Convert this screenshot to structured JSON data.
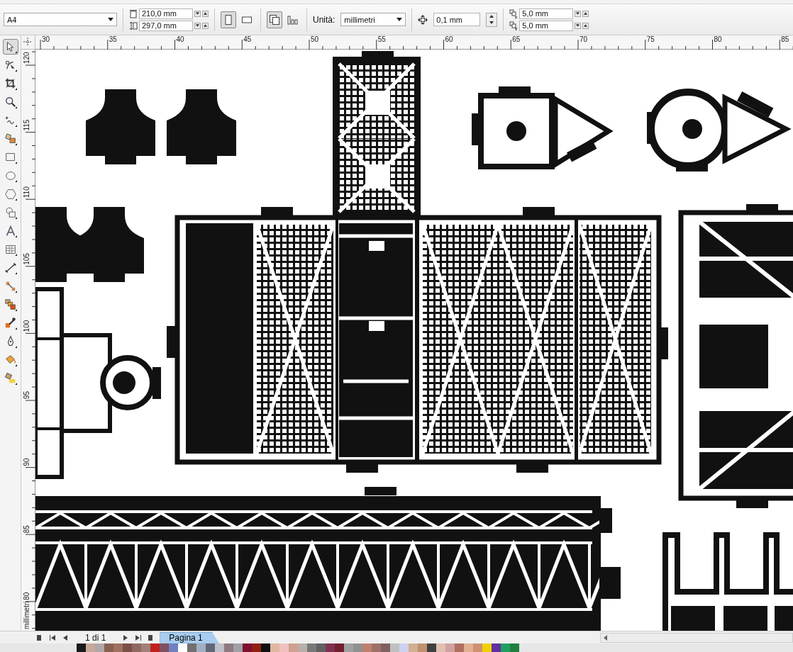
{
  "property_bar": {
    "paper_size": "A4",
    "width": "210,0 mm",
    "height": "297,0 mm",
    "orientations": [
      {
        "kind": "portrait",
        "selected": true
      },
      {
        "kind": "landscape",
        "selected": false
      }
    ],
    "page_modes": [
      {
        "kind": "all_pages",
        "selected": true
      },
      {
        "kind": "current_page",
        "selected": false
      }
    ],
    "units_label": "Unità:",
    "units": "millimetri",
    "nudge": "0,1 mm",
    "duplicate_x": "5,0 mm",
    "duplicate_y": "5,0 mm"
  },
  "toolbox": [
    {
      "kind": "pick",
      "selected": true
    },
    {
      "kind": "shape",
      "selected": false
    },
    {
      "kind": "crop",
      "selected": false
    },
    {
      "kind": "zoom",
      "selected": false
    },
    {
      "kind": "freehand",
      "selected": false
    },
    {
      "kind": "smart_fill",
      "selected": false
    },
    {
      "kind": "rectangle",
      "selected": false
    },
    {
      "kind": "ellipse",
      "selected": false
    },
    {
      "kind": "polygon",
      "selected": false
    },
    {
      "kind": "basic_shapes",
      "selected": false
    },
    {
      "kind": "text",
      "selected": false
    },
    {
      "kind": "table",
      "selected": false
    },
    {
      "kind": "dimension",
      "selected": false
    },
    {
      "kind": "connector",
      "selected": false
    },
    {
      "kind": "blend",
      "selected": false
    },
    {
      "kind": "eyedropper",
      "selected": false
    },
    {
      "kind": "outline",
      "selected": false
    },
    {
      "kind": "fill",
      "selected": false
    },
    {
      "kind": "interactive_fill",
      "selected": false
    }
  ],
  "ruler": {
    "horizontal": [
      "30",
      "35",
      "40",
      "45",
      "50",
      "55",
      "60",
      "65",
      "70",
      "75",
      "80",
      "85"
    ],
    "vertical": [
      "120",
      "115",
      "110",
      "105",
      "100",
      "95",
      "90",
      "85",
      "80"
    ],
    "unit": "millimetri"
  },
  "page_nav": {
    "page_count": "1 di 1",
    "tabs": [
      {
        "label": "Pagina 1",
        "selected": true
      }
    ]
  },
  "palette": [
    {
      "color": "#1a1a1a"
    },
    {
      "color": "#c8a898"
    },
    {
      "color": "#b0a8a8"
    },
    {
      "color": "#8a6050"
    },
    {
      "color": "#a07060"
    },
    {
      "color": "#7a5048"
    },
    {
      "color": "#906860"
    },
    {
      "color": "#a08078"
    },
    {
      "color": "#c02020"
    },
    {
      "color": "#805060"
    },
    {
      "color": "#7080c0"
    },
    {
      "color": "#ffffff"
    },
    {
      "color": "#707070"
    },
    {
      "color": "#a0b0c0"
    },
    {
      "color": "#606878"
    },
    {
      "color": "#c0c0c8"
    },
    {
      "color": "#907880"
    },
    {
      "color": "#a0a0a8"
    },
    {
      "color": "#801030"
    },
    {
      "color": "#902010"
    },
    {
      "color": "#101010"
    },
    {
      "color": "#e0b8a0"
    },
    {
      "color": "#f0c0c0"
    },
    {
      "color": "#d0a090"
    },
    {
      "color": "#b8b0a8"
    },
    {
      "color": "#787878"
    },
    {
      "color": "#606060"
    },
    {
      "color": "#803050"
    },
    {
      "color": "#702030"
    },
    {
      "color": "#a0a0a0"
    },
    {
      "color": "#909090"
    },
    {
      "color": "#c08070"
    },
    {
      "color": "#a07068"
    },
    {
      "color": "#806060"
    },
    {
      "color": "#c0c0c0"
    },
    {
      "color": "#d0d0f0"
    },
    {
      "color": "#d0b090"
    },
    {
      "color": "#c09070"
    },
    {
      "color": "#404040"
    },
    {
      "color": "#e0c0b0"
    },
    {
      "color": "#d0a0a0"
    },
    {
      "color": "#b07060"
    },
    {
      "color": "#e0b090"
    },
    {
      "color": "#d09070"
    },
    {
      "color": "#f0d000"
    },
    {
      "color": "#6030a0"
    },
    {
      "color": "#20a060"
    },
    {
      "color": "#208040"
    }
  ]
}
